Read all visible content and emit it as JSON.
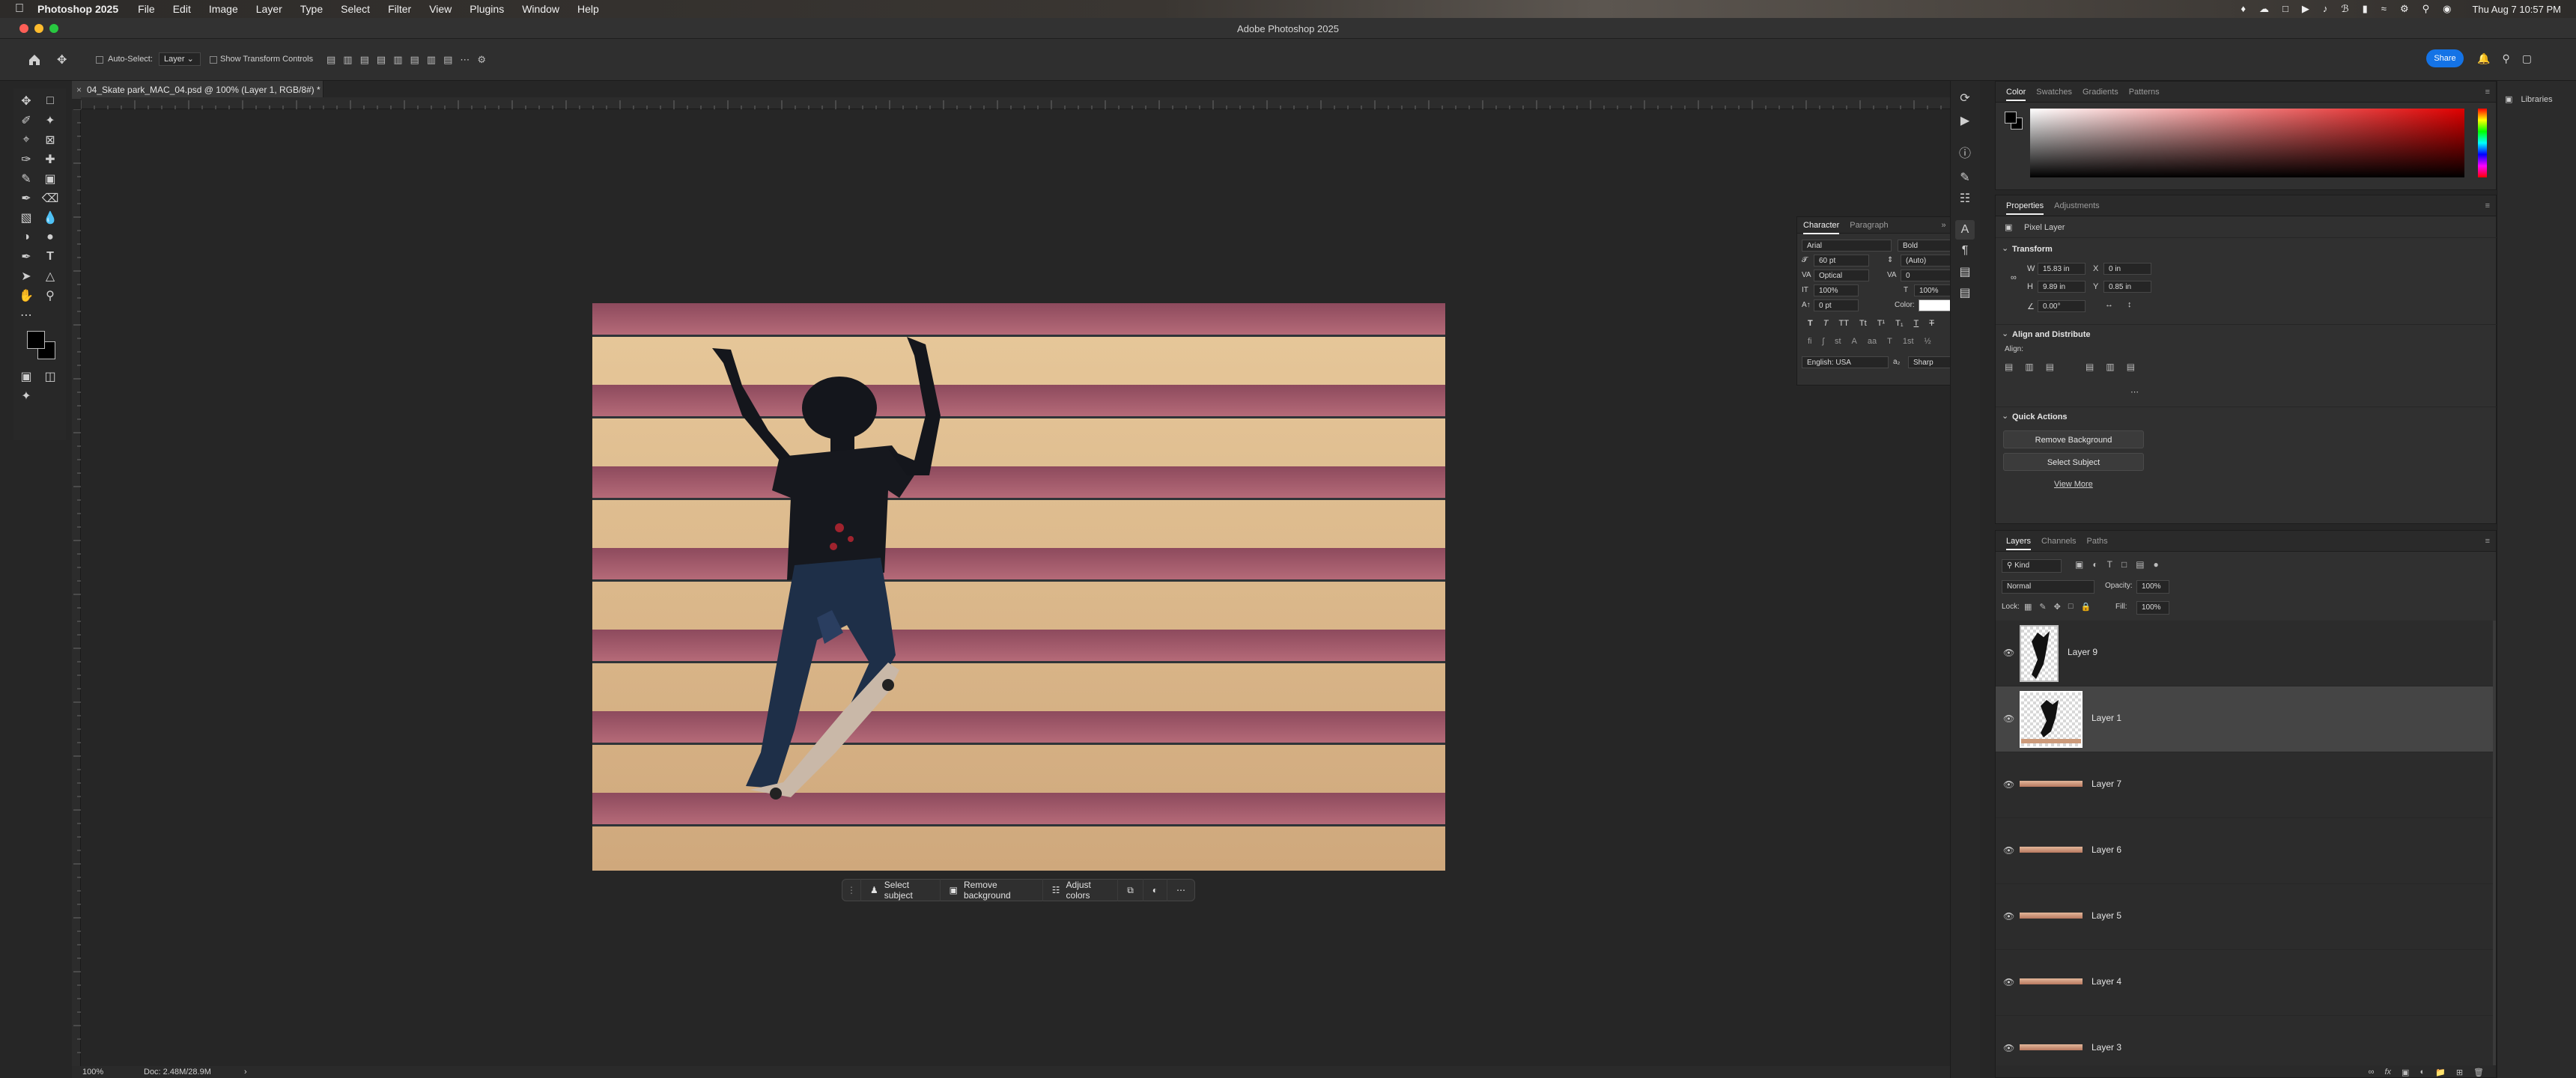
{
  "menubar": {
    "app_name": "Photoshop 2025",
    "menus": [
      "File",
      "Edit",
      "Image",
      "Layer",
      "Type",
      "Select",
      "Filter",
      "View",
      "Plugins",
      "Window",
      "Help"
    ],
    "clock": "Thu Aug 7  10:57 PM"
  },
  "window": {
    "title": "Adobe Photoshop 2025",
    "share_label": "Share"
  },
  "options": {
    "auto_select_label": "Auto-Select:",
    "auto_select_value": "Layer",
    "transform_label": "Show Transform Controls"
  },
  "document": {
    "tab_title": "04_Skate park_MAC_04.psd @ 100% (Layer 1, RGB/8#) *"
  },
  "context_bar": {
    "select_subject": "Select subject",
    "remove_background": "Remove background",
    "adjust_colors": "Adjust colors"
  },
  "status": {
    "zoom": "100%",
    "doc": "Doc: 2.48M/28.9M"
  },
  "character": {
    "tabs": [
      "Character",
      "Paragraph"
    ],
    "font_family": "Arial",
    "font_style": "Bold",
    "size": "60 pt",
    "leading": "(Auto)",
    "kerning": "Optical",
    "tracking": "0",
    "vscale": "100%",
    "hscale": "100%",
    "baseline": "0 pt",
    "color_label": "Color:",
    "language": "English: USA",
    "antialias": "Sharp"
  },
  "color_panel": {
    "tabs": [
      "Color",
      "Swatches",
      "Gradients",
      "Patterns"
    ],
    "hue": "#e00000"
  },
  "properties": {
    "tabs": [
      "Properties",
      "Adjustments"
    ],
    "layer_type": "Pixel Layer",
    "transform_title": "Transform",
    "w_label": "W",
    "w": "15.83 in",
    "h_label": "H",
    "h": "9.89 in",
    "x_label": "X",
    "x": "0 in",
    "y_label": "Y",
    "y": "0.85 in",
    "angle": "0.00°",
    "align_title": "Align and Distribute",
    "align_label": "Align:",
    "quick_title": "Quick Actions",
    "remove_bg": "Remove Background",
    "select_subject": "Select Subject",
    "view_more": "View More"
  },
  "layers_panel": {
    "tabs": [
      "Layers",
      "Channels",
      "Paths"
    ],
    "filter": "Kind",
    "blend": "Normal",
    "opacity_label": "Opacity:",
    "opacity": "100%",
    "lock_label": "Lock:",
    "fill_label": "Fill:",
    "fill": "100%",
    "layers": [
      "Layer 9",
      "Layer 1",
      "Layer 7",
      "Layer 6",
      "Layer 5",
      "Layer 4",
      "Layer 3"
    ]
  },
  "libraries": {
    "label": "Libraries"
  }
}
